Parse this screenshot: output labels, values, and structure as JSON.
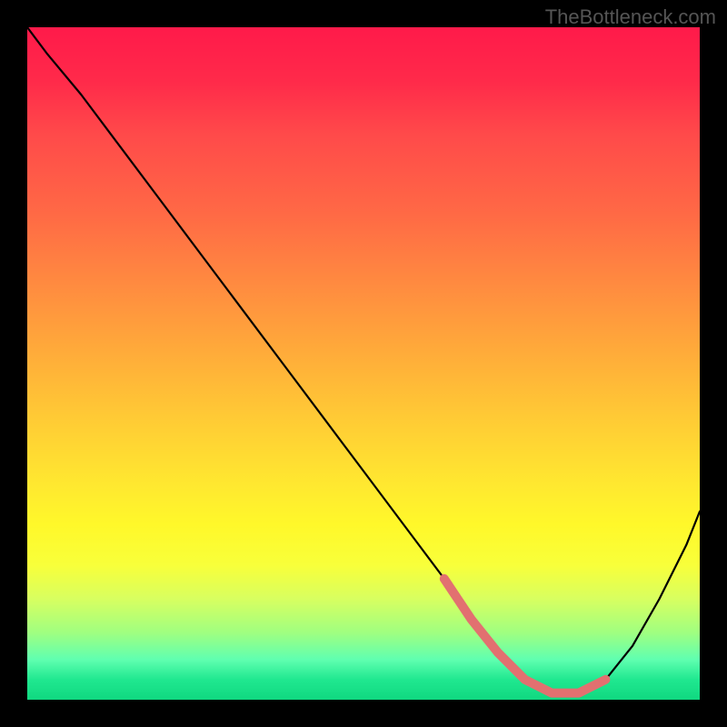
{
  "watermark": "TheBottleneck.com",
  "chart_data": {
    "type": "line",
    "title": "",
    "xlabel": "",
    "ylabel": "",
    "xlim": [
      0,
      100
    ],
    "ylim": [
      0,
      100
    ],
    "series": [
      {
        "name": "main-curve",
        "color": "#000000",
        "x": [
          0,
          3,
          8,
          14,
          20,
          26,
          32,
          38,
          44,
          50,
          56,
          62,
          66,
          70,
          74,
          78,
          82,
          86,
          90,
          94,
          98,
          100
        ],
        "values": [
          100,
          96,
          90,
          82,
          74,
          66,
          58,
          50,
          42,
          34,
          26,
          18,
          12,
          7,
          3,
          1,
          1,
          3,
          8,
          15,
          23,
          28
        ]
      },
      {
        "name": "trough-highlight",
        "color": "#e27070",
        "x": [
          62,
          66,
          70,
          74,
          78,
          82,
          86
        ],
        "values": [
          18,
          12,
          7,
          3,
          1,
          1,
          3
        ]
      }
    ],
    "gradient_stops": [
      {
        "pos": 0,
        "color": "#ff1a4a"
      },
      {
        "pos": 50,
        "color": "#ffaa3a"
      },
      {
        "pos": 75,
        "color": "#fff82a"
      },
      {
        "pos": 100,
        "color": "#10d880"
      }
    ]
  }
}
